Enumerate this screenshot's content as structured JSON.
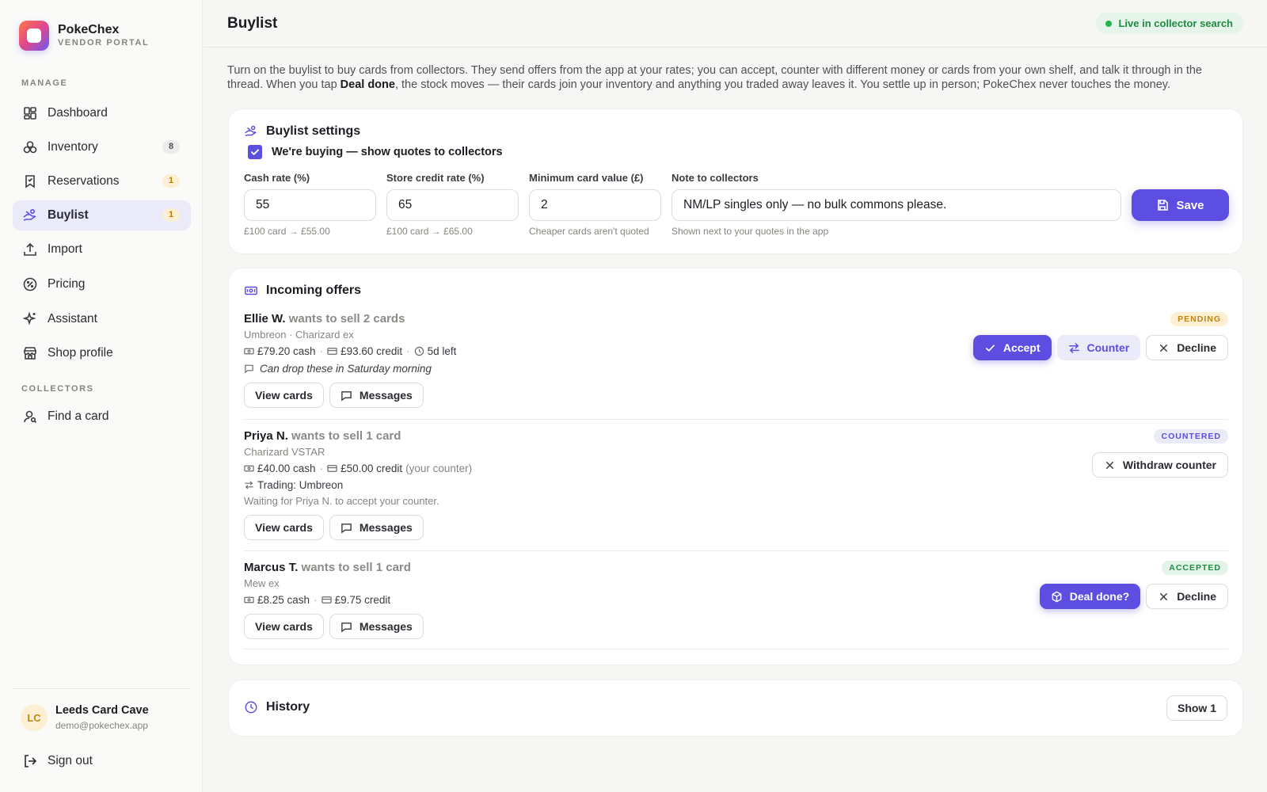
{
  "brand": {
    "name": "PokeChex",
    "subtitle": "VENDOR PORTAL"
  },
  "sidebar": {
    "manage_label": "MANAGE",
    "collectors_label": "COLLECTORS",
    "items": [
      {
        "label": "Dashboard",
        "icon": "dashboard-icon"
      },
      {
        "label": "Inventory",
        "icon": "cards-stack-icon",
        "badge": "8"
      },
      {
        "label": "Reservations",
        "icon": "bookmark-icon",
        "badge": "1"
      },
      {
        "label": "Buylist",
        "icon": "hand-coins-icon",
        "badge": "1",
        "active": true
      },
      {
        "label": "Import",
        "icon": "upload-icon"
      },
      {
        "label": "Pricing",
        "icon": "percent-badge-icon"
      },
      {
        "label": "Assistant",
        "icon": "sparkles-icon"
      },
      {
        "label": "Shop profile",
        "icon": "store-icon"
      }
    ],
    "collector_items": [
      {
        "label": "Find a card",
        "icon": "user-search-icon"
      }
    ],
    "user": {
      "initials": "LC",
      "name": "Leeds Card Cave",
      "email": "demo@pokechex.app"
    },
    "signout_label": "Sign out"
  },
  "header": {
    "title": "Buylist",
    "status": "Live in collector search"
  },
  "intro": {
    "part1": "Turn on the buylist to buy cards from collectors. They send offers from the app at your rates; you can accept, counter with different money or cards from your own shelf, and talk it through in the thread. When you tap ",
    "bold": "Deal done",
    "part2": ", the stock moves — their cards join your inventory and anything you traded away leaves it. You settle up in person; PokeChex never touches the money."
  },
  "settings": {
    "title": "Buylist settings",
    "buying_label": "We're buying — show quotes to collectors",
    "buying_checked": true,
    "cash_rate": {
      "label": "Cash rate (%)",
      "value": "55",
      "help": "£100 card → £55.00"
    },
    "credit_rate": {
      "label": "Store credit rate (%)",
      "value": "65",
      "help": "£100 card → £65.00"
    },
    "min_value": {
      "label": "Minimum card value (£)",
      "value": "2",
      "help": "Cheaper cards aren't quoted"
    },
    "note": {
      "label": "Note to collectors",
      "value": "NM/LP singles only — no bulk commons please.",
      "help": "Shown next to your quotes in the app"
    },
    "save_label": "Save"
  },
  "offers": {
    "title": "Incoming offers",
    "items": [
      {
        "name": "Ellie W.",
        "action": "wants to sell 2 cards",
        "cards": "Umbreon · Charizard ex",
        "cash": "£79.20 cash",
        "credit": "£93.60 credit",
        "time": "5d left",
        "note": "Can drop these in Saturday morning",
        "status": "PENDING",
        "accept_label": "Accept",
        "counter_label": "Counter",
        "decline_label": "Decline",
        "view_label": "View cards",
        "messages_label": "Messages"
      },
      {
        "name": "Priya N.",
        "action": "wants to sell 1 card",
        "cards": "Charizard VSTAR",
        "cash": "£40.00 cash",
        "credit": "£50.00 credit",
        "counter_note": "(your counter)",
        "trading": "Trading: Umbreon",
        "waiting": "Waiting for Priya N. to accept your counter.",
        "status": "COUNTERED",
        "withdraw_label": "Withdraw counter",
        "view_label": "View cards",
        "messages_label": "Messages"
      },
      {
        "name": "Marcus T.",
        "action": "wants to sell 1 card",
        "cards": "Mew ex",
        "cash": "£8.25 cash",
        "credit": "£9.75 credit",
        "status": "ACCEPTED",
        "deal_label": "Deal done?",
        "decline_label": "Decline",
        "view_label": "View cards",
        "messages_label": "Messages"
      }
    ]
  },
  "history": {
    "title": "History",
    "show_label": "Show 1"
  },
  "colors": {
    "accent": "#5b4ee0",
    "pending": "#c0840f",
    "accepted": "#1f8a42",
    "live": "#26b34d"
  }
}
